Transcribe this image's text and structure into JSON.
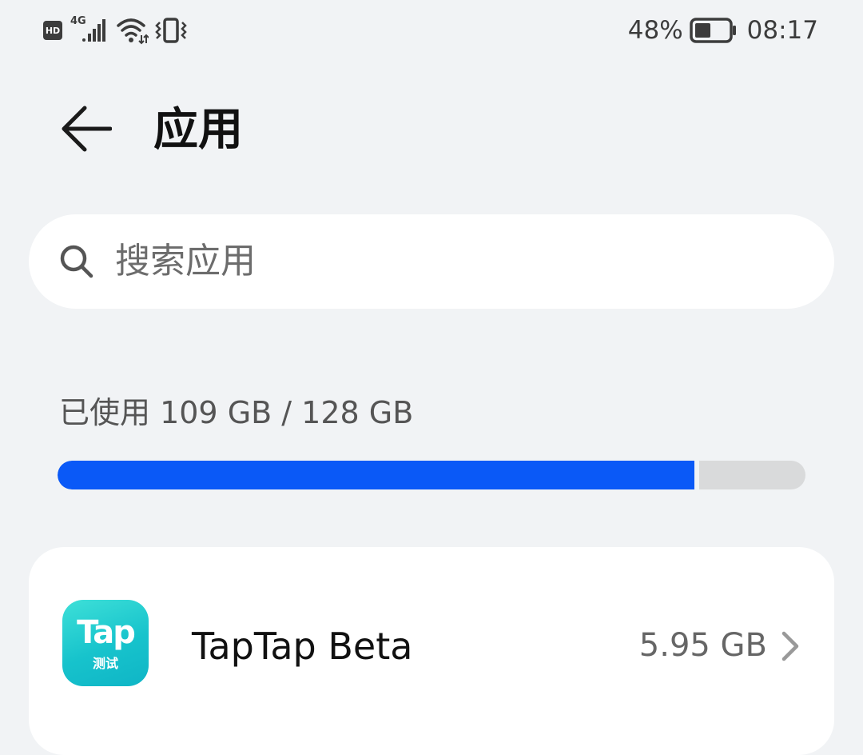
{
  "status_bar": {
    "hd_label": "HD",
    "network_label": "4G",
    "battery_percent": "48%",
    "battery_level": 0.48,
    "time": "08:17",
    "icons": [
      "hd-icon",
      "cellular-signal-icon",
      "wifi-icon",
      "vibrate-icon",
      "battery-icon"
    ]
  },
  "header": {
    "title": "应用",
    "back_icon": "arrow-left-icon"
  },
  "search": {
    "placeholder": "搜索应用",
    "icon": "search-icon"
  },
  "storage": {
    "label": "已使用 109 GB / 128 GB",
    "used_gb": 109,
    "total_gb": 128,
    "used_fraction": 0.852,
    "fill_color": "#0a59f7",
    "track_color": "#d9dadb"
  },
  "apps": [
    {
      "name": "TapTap Beta",
      "size": "5.95 GB",
      "icon_text": "Tap",
      "icon_subtext": "测试",
      "icon_color": "#17c3cc"
    }
  ],
  "colors": {
    "background": "#f1f3f5",
    "card": "#ffffff",
    "accent": "#0a59f7"
  }
}
